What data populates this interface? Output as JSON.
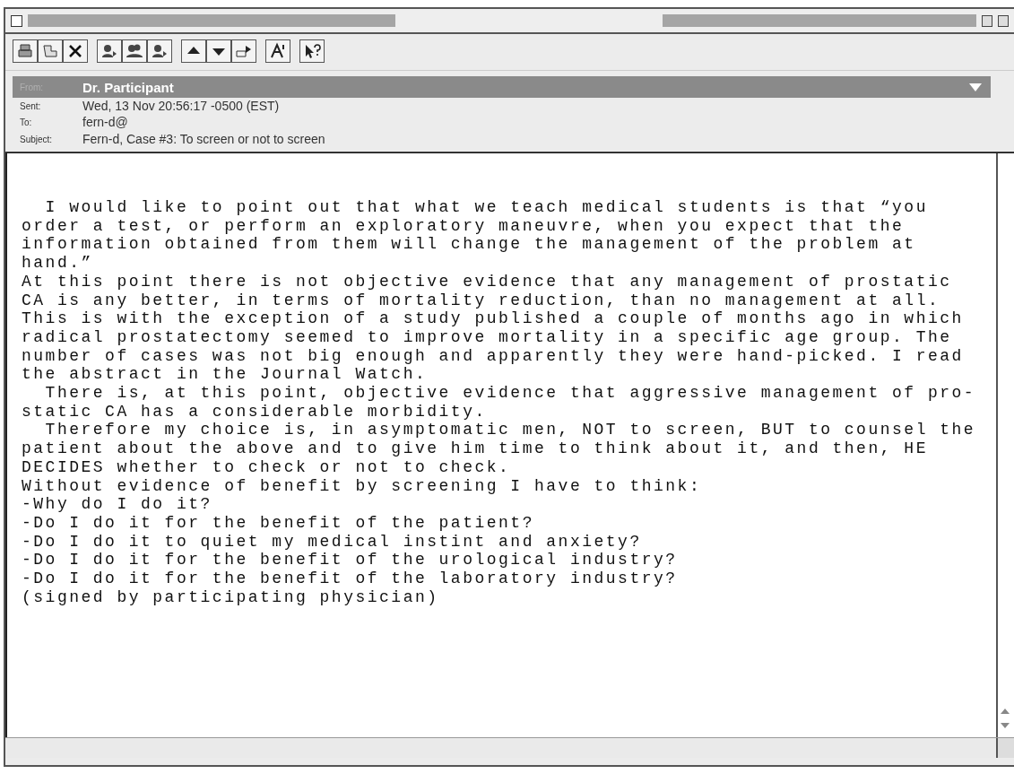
{
  "header": {
    "from_label": "From:",
    "from": "Dr. Participant",
    "fields": [
      {
        "label": "Sent:",
        "value": "Wed, 13 Nov 20:56:17 -0500 (EST)"
      },
      {
        "label": "To:",
        "value": "fern-d@"
      },
      {
        "label": "Subject:",
        "value": "Fern-d, Case #3: To screen or not to screen"
      }
    ]
  },
  "body": {
    "lines": [
      "  I would like to point out that what we teach medical students is that “you",
      "order a test, or perform an exploratory maneuvre, when you expect that the",
      "information obtained from them will change the management of the problem at",
      "hand.”",
      "At this point there is not objective evidence that any management of prostatic",
      "CA is any better, in terms of mortality reduction, than no management at all.",
      "This is with the exception of a study published a couple of months ago in which",
      "radical prostatectomy seemed to improve mortality in a specific age group. The",
      "number of cases was not big enough and apparently they were hand-picked. I read",
      "the abstract in the Journal Watch.",
      "  There is, at this point, objective evidence that aggressive management of pro-",
      "static CA has a considerable morbidity.",
      "  Therefore my choice is, in asymptomatic men, NOT to screen, BUT to counsel the",
      "patient about the above and to give him time to think about it, and then, HE",
      "DECIDES whether to check or not to check.",
      "Without evidence of benefit by screening I have to think:",
      "-Why do I do it?",
      "-Do I do it for the benefit of the patient?",
      "-Do I do it to quiet my medical instint and anxiety?",
      "-Do I do it for the benefit of the urological industry?",
      "-Do I do it for the benefit of the laboratory industry?",
      "(signed by participating physician)"
    ]
  }
}
